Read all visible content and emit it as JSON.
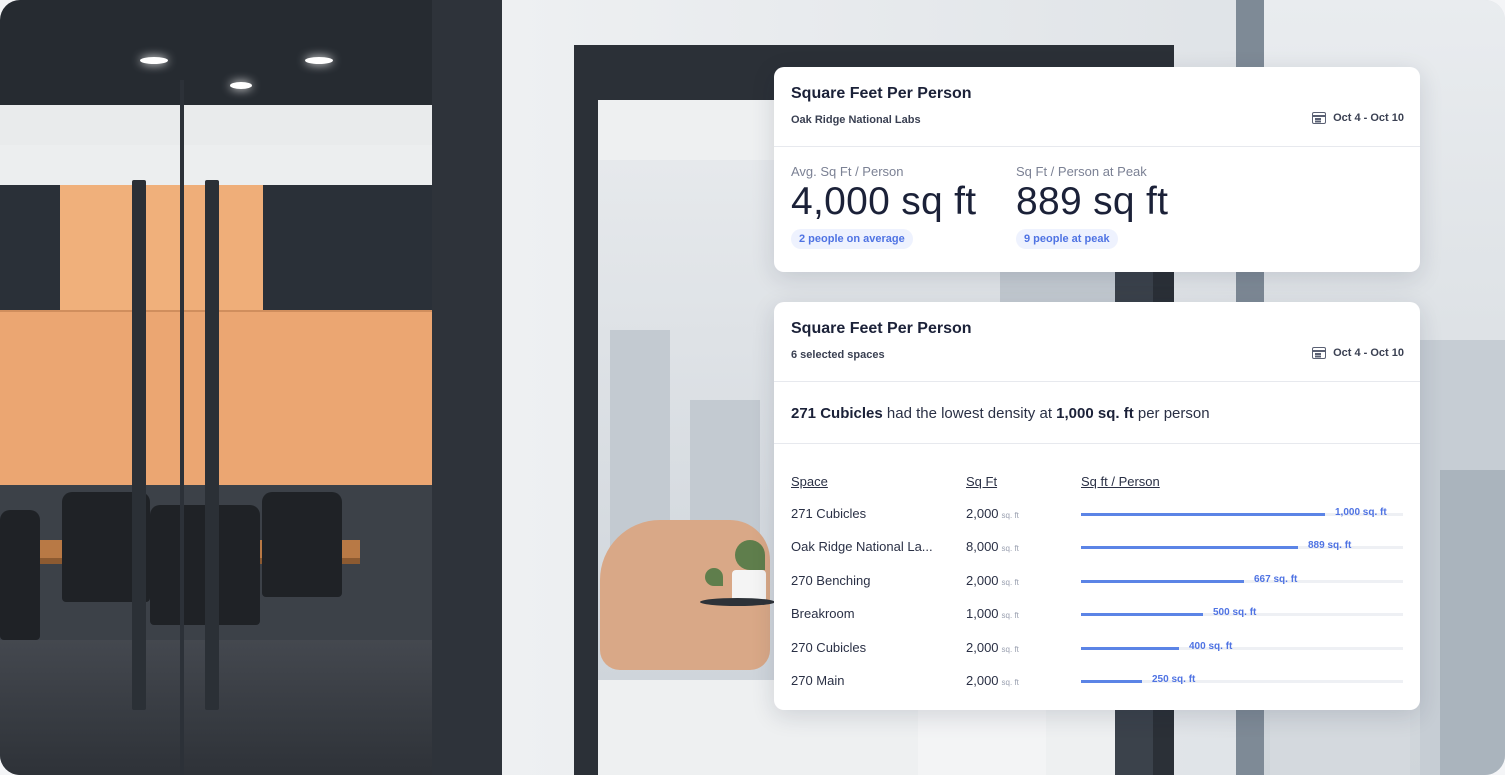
{
  "card_top": {
    "title": "Square Feet Per Person",
    "subtitle": "Oak Ridge National Labs",
    "date_range": "Oct 4 - Oct 10",
    "metrics": [
      {
        "label": "Avg. Sq Ft / Person",
        "value": "4,000 sq ft",
        "badge": "2 people on average"
      },
      {
        "label": "Sq Ft / Person at Peak",
        "value": "889 sq ft",
        "badge": "9 people at peak"
      }
    ]
  },
  "card_bottom": {
    "title": "Square Feet Per Person",
    "subtitle": "6 selected spaces",
    "date_range": "Oct 4 - Oct 10",
    "insight": {
      "space": "271 Cubicles",
      "middle": " had the lowest density at ",
      "value": "1,000 sq. ft",
      "end": " per person"
    },
    "headers": {
      "space": "Space",
      "sqft": "Sq Ft",
      "per_person": "Sq ft / Person"
    },
    "unit_label": "sq. ft",
    "rows": [
      {
        "space": "271 Cubicles",
        "sqft": "2,000",
        "per_person_label": "1,000 sq. ft",
        "per_person": 1000
      },
      {
        "space": "Oak Ridge National La...",
        "sqft": "8,000",
        "per_person_label": "889 sq. ft",
        "per_person": 889
      },
      {
        "space": "270 Benching",
        "sqft": "2,000",
        "per_person_label": "667 sq. ft",
        "per_person": 667
      },
      {
        "space": "Breakroom",
        "sqft": "1,000",
        "per_person_label": "500 sq. ft",
        "per_person": 500
      },
      {
        "space": "270 Cubicles",
        "sqft": "2,000",
        "per_person_label": "400 sq. ft",
        "per_person": 400
      },
      {
        "space": "270 Main",
        "sqft": "2,000",
        "per_person_label": "250 sq. ft",
        "per_person": 250
      }
    ]
  },
  "colors": {
    "accent": "#5b84e6",
    "badge_bg": "#eef2fe",
    "title": "#1b2138"
  },
  "icons": {
    "date": "calendar-icon"
  }
}
